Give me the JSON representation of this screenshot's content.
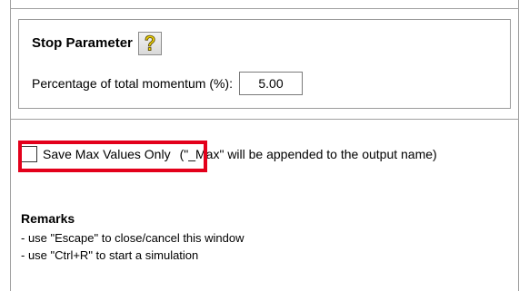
{
  "stop_parameter": {
    "title": "Stop Parameter",
    "help_icon": "question-mark-icon",
    "momentum_label": "Percentage of total momentum (%):",
    "momentum_value": "5.00"
  },
  "save_option": {
    "checkbox_label": "Save Max Values Only",
    "checked": false,
    "note": "(\"_Max\" will be appended to the output name)"
  },
  "remarks": {
    "title": "Remarks",
    "lines": [
      "- use \"Escape\" to close/cancel this window",
      "- use \"Ctrl+R\" to start a simulation"
    ]
  },
  "colors": {
    "highlight": "#e3001b",
    "help_icon_fill": "#f5d90a"
  }
}
